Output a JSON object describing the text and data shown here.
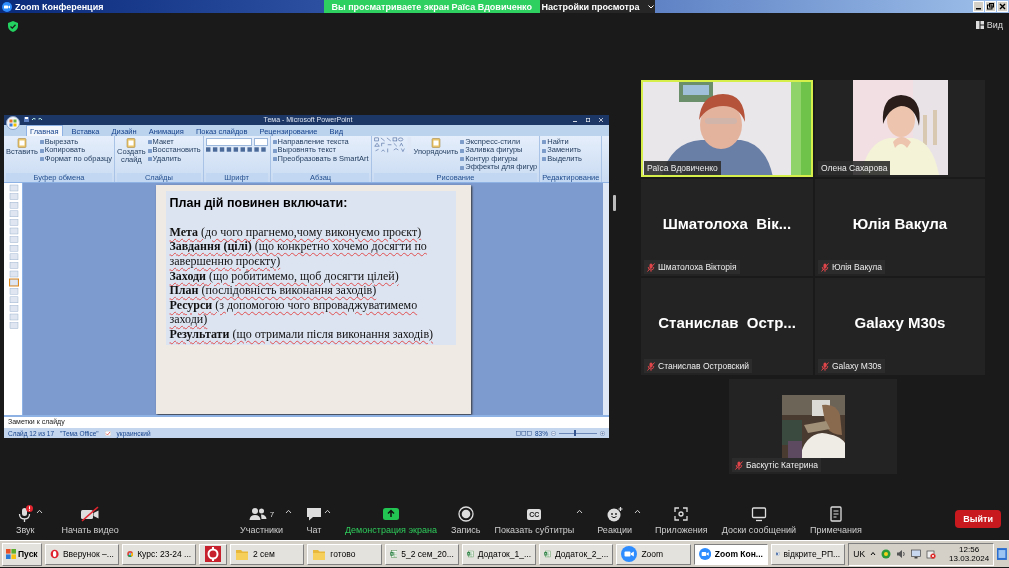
{
  "window": {
    "title": "Zoom Конференция"
  },
  "share_banner": {
    "text": "Вы просматриваете экран Раїса Вдовиченко",
    "options": "Настройки просмотра"
  },
  "view_button": "Вид",
  "shared_screen": {
    "title": "Тема - Microsoft PowerPoint",
    "tabs": [
      {
        "label": "Главная",
        "selected": true
      },
      {
        "label": "Вставка",
        "selected": false
      },
      {
        "label": "Дизайн",
        "selected": false
      },
      {
        "label": "Анимация",
        "selected": false
      },
      {
        "label": "Показ слайдов",
        "selected": false
      },
      {
        "label": "Рецензирование",
        "selected": false
      },
      {
        "label": "Вид",
        "selected": false
      }
    ],
    "ribbon_groups": [
      {
        "kind": "commands",
        "label": "Буфер обмена",
        "big": "Вставить",
        "commands": [
          "Вырезать",
          "Копировать",
          "Формат по образцу"
        ]
      },
      {
        "kind": "commands",
        "label": "Слайды",
        "big": "Создать слайд",
        "commands": [
          "Макет",
          "Восстановить",
          "Удалить"
        ]
      },
      {
        "kind": "font",
        "label": "Шрифт"
      },
      {
        "kind": "commands",
        "label": "Абзац",
        "commands": [
          "Направление текста",
          "Выровнять текст",
          "Преобразовать в SmartArt"
        ]
      },
      {
        "kind": "drawing",
        "label": "Рисование",
        "big": "Упорядочить",
        "commands": [
          "Экспресс-стили",
          "Заливка фигуры",
          "Контур фигуры",
          "Эффекты для фигур"
        ]
      },
      {
        "kind": "commands",
        "label": "Редактирование",
        "commands": [
          "Найти",
          "Заменить",
          "Выделить"
        ]
      }
    ],
    "slide_title": "План дій повинен включати:",
    "slide_items": [
      "**Мета** (до чого прагнемо,чому виконуємо проєкт)",
      "**Завдання (цілі)** (що конкретно хочемо досягти по завершенню проєкту)",
      "**Заходи** (що робитимемо, щоб досягти цілей)",
      "**План** (послідовність виконання заходів)",
      "**Ресурси** (з допомогою чого впроваджуватимемо заходи)",
      "**Результати** (що отримали після виконання заходів)"
    ],
    "notes_placeholder": "Заметки к слайду",
    "status": [
      "Слайд 12 из 17",
      "\"Тема Office\"",
      "украинский"
    ],
    "zoom": "83%",
    "zoom_slider": {
      "level": 0.42
    }
  },
  "participants": [
    {
      "kind": "camera",
      "name": "Раїса Вдовиченко",
      "muted": false,
      "speaking": true
    },
    {
      "kind": "portrait",
      "name": "Олена Сахарова",
      "muted": false,
      "speaking": false
    },
    {
      "kind": "name",
      "display_name": "Шматолоха  Вік...",
      "name": "Шматолоха Вікторія",
      "muted": true,
      "speaking": false
    },
    {
      "kind": "name",
      "display_name": "Юлія Вакула",
      "name": "Юлія Вакула",
      "muted": true,
      "speaking": false
    },
    {
      "kind": "name",
      "display_name": "Станислав  Остр...",
      "name": "Станислав Островский",
      "muted": true,
      "speaking": false
    },
    {
      "kind": "name",
      "display_name": "Galaxy M30s",
      "name": "Galaxy M30s",
      "muted": true,
      "speaking": false
    },
    {
      "kind": "avatar",
      "name": "Баскутіс Катерина",
      "muted": true,
      "speaking": false
    }
  ],
  "toolbar": [
    {
      "kind": "audio",
      "label": "Звук",
      "menu": true,
      "alert": true
    },
    {
      "kind": "video",
      "label": "Начать видео",
      "menu": false,
      "on": false
    },
    {
      "kind": "participants",
      "label": "Участники",
      "count": "7",
      "menu": true
    },
    {
      "kind": "chat",
      "label": "Чат",
      "menu": true
    },
    {
      "kind": "share",
      "label": "Демонстрация экрана",
      "menu": false,
      "active": true
    },
    {
      "kind": "record",
      "label": "Запись",
      "menu": false
    },
    {
      "kind": "captions",
      "label": "Показать субтитры",
      "icon_text": "CC",
      "menu": true
    },
    {
      "kind": "reactions",
      "label": "Реакции",
      "menu": true
    },
    {
      "kind": "apps",
      "label": "Приложения",
      "menu": false
    },
    {
      "kind": "whiteboards",
      "label": "Доски сообщений",
      "menu": false
    },
    {
      "kind": "notes",
      "label": "Примечания",
      "menu": false
    }
  ],
  "leave_button": "Выйти",
  "taskbar": {
    "start": "Пуск",
    "items": [
      {
        "kind": "opera",
        "label": "Вверунок –...",
        "selected": false
      },
      {
        "kind": "chrome",
        "label": "Курс: 23-24 ...",
        "selected": false
      },
      {
        "kind": "app",
        "selected": false
      },
      {
        "kind": "folder",
        "label": "2 сем",
        "selected": false
      },
      {
        "kind": "folder",
        "label": "готово",
        "selected": false
      },
      {
        "kind": "excel",
        "label": "5_2 сем_20...",
        "selected": false
      },
      {
        "kind": "excel",
        "label": "Додаток_1_...",
        "selected": false
      },
      {
        "kind": "excel",
        "label": "Додаток_2_...",
        "selected": false
      },
      {
        "kind": "zoom",
        "label": "Zoom",
        "selected": false
      },
      {
        "kind": "zoom",
        "label": "Zoom Кон...",
        "selected": true
      },
      {
        "kind": "word",
        "label": "відкрите_РП...",
        "selected": false
      }
    ],
    "language": "UK",
    "time": "12:56",
    "date": "13.03.2024"
  }
}
